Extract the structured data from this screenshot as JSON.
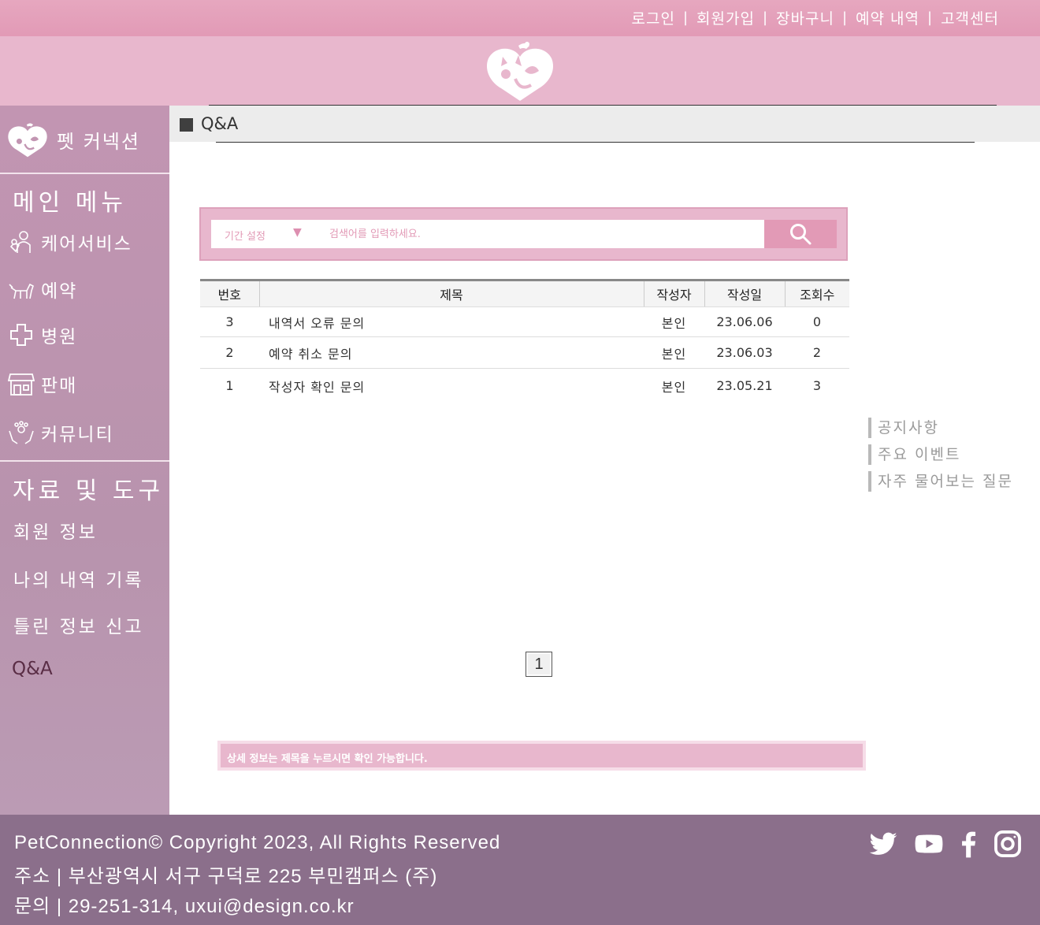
{
  "top_links": {
    "login": "로그인",
    "signup": "회원가입",
    "cart": "장바구니",
    "reservations": "예약 내역",
    "support": "고객센터",
    "separator": "|"
  },
  "sidebar": {
    "brand": "펫 커넥션",
    "main_heading": "메인 메뉴",
    "main_items": [
      {
        "label": "케어서비스",
        "icon": "care-service-icon"
      },
      {
        "label": "예약",
        "icon": "dog-icon"
      },
      {
        "label": "병원",
        "icon": "hospital-cross-icon"
      },
      {
        "label": "판매",
        "icon": "store-icon"
      },
      {
        "label": "커뮤니티",
        "icon": "community-hands-icon"
      }
    ],
    "tools_heading": "자료 및 도구",
    "tools_items": [
      "회원 정보",
      "나의 내역 기록",
      "틀린 정보 신고",
      "Q&A"
    ]
  },
  "page": {
    "title": "Q&A"
  },
  "search": {
    "period_label": "기간 설정",
    "period_arrow": "▼",
    "placeholder": "검색어를 입력하세요."
  },
  "table": {
    "headers": [
      "번호",
      "제목",
      "작성자",
      "작성일",
      "조회수"
    ],
    "rows": [
      {
        "no": "3",
        "title": "내역서 오류 문의",
        "writer": "본인",
        "date": "23.06.06",
        "views": "0"
      },
      {
        "no": "2",
        "title": "예약 취소 문의",
        "writer": "본인",
        "date": "23.06.03",
        "views": "2"
      },
      {
        "no": "1",
        "title": "작성자 확인 문의",
        "writer": "본인",
        "date": "23.05.21",
        "views": "3"
      }
    ]
  },
  "quick_links": [
    "공지사항",
    "주요 이벤트",
    "자주 물어보는 질문"
  ],
  "pagination": {
    "current": "1"
  },
  "notice": "상세 정보는 제목을 누르시면 확인 가능합니다.",
  "footer": {
    "copyright": "PetConnection© Copyright 2023, All Rights Reserved",
    "address": "주소 | 부산광역시 서구 구덕로 225 부민캠퍼스 (주)",
    "contact": "문의 | 29-251-314, uxui@design.co.kr",
    "social": [
      "twitter-icon",
      "youtube-icon",
      "facebook-icon",
      "instagram-icon"
    ]
  },
  "colors": {
    "topbar": "#e29ab6",
    "header": "#e8b7cd",
    "sidebar": "#b893ad",
    "footer": "#8b6f8b",
    "accent": "#e29ab6"
  }
}
